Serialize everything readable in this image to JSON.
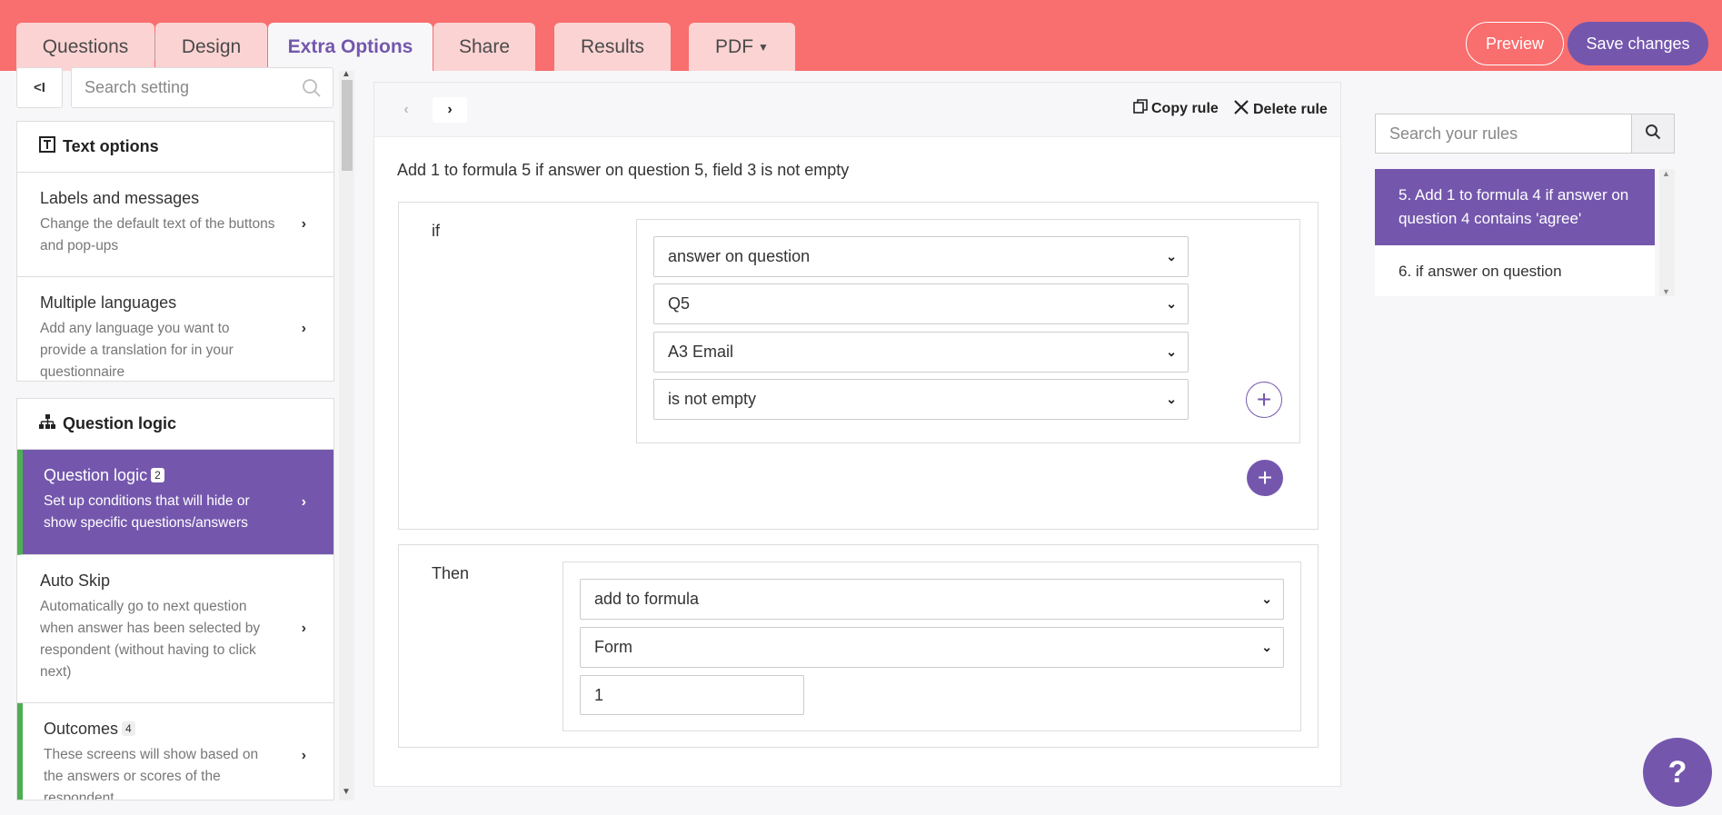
{
  "tabs": [
    {
      "label": "Questions"
    },
    {
      "label": "Design"
    },
    {
      "label": "Extra Options"
    },
    {
      "label": "Share"
    },
    {
      "label": "Results"
    },
    {
      "label": "PDF"
    }
  ],
  "header": {
    "preview_label": "Preview",
    "save_label": "Save changes"
  },
  "sidebar": {
    "collapse_icon": "<I",
    "search_placeholder": "Search setting",
    "text_options": {
      "heading": "Text options",
      "items": [
        {
          "title": "Labels and messages",
          "desc": "Change the default text of the buttons and pop-ups"
        },
        {
          "title": "Multiple languages",
          "desc": "Add any language you want to provide a translation for in your questionnaire"
        }
      ]
    },
    "question_logic": {
      "heading": "Question logic",
      "items": [
        {
          "title": "Question logic",
          "badge": "2",
          "desc": "Set up conditions that will hide or show specific questions/answers"
        },
        {
          "title": "Auto Skip",
          "desc": "Automatically go to next question when answer has been selected by respondent (without having to click next)"
        },
        {
          "title": "Outcomes",
          "badge": "4",
          "desc": "These screens will show based on the answers or scores of the respondent"
        }
      ]
    }
  },
  "editor": {
    "copy_label": "Copy rule",
    "delete_label": "Delete rule",
    "rule_title": "Add 1 to formula 5 if answer on question 5, field 3 is not empty",
    "if_label": "if",
    "conditions": [
      "answer on question",
      "Q5",
      "A3 Email",
      "is not empty"
    ],
    "then_label": "Then",
    "actions": [
      "add to formula",
      "Form"
    ],
    "value": "1"
  },
  "rules_panel": {
    "search_placeholder": "Search your rules",
    "rules": [
      {
        "label": "5. Add 1 to formula 4 if answer on question 4 contains 'agree'"
      },
      {
        "label": "6. if answer on question"
      }
    ]
  },
  "help": {
    "label": "?"
  },
  "colors": {
    "brand": "#7457ad",
    "topbar": "#f96e6e",
    "accent_green": "#4caf50"
  }
}
